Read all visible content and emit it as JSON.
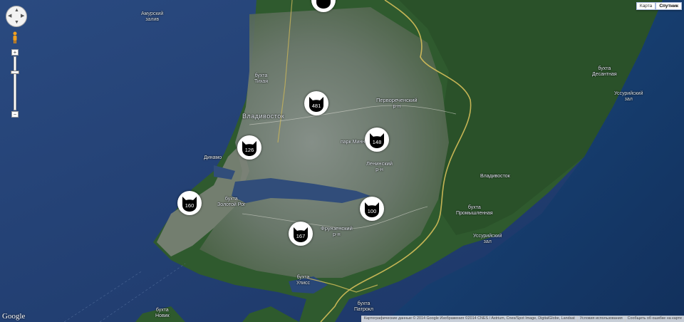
{
  "map_type": {
    "map_label": "Карта",
    "satellite_label": "Спутник",
    "selected": "satellite"
  },
  "zoom": {
    "plus": "+",
    "minus": "−"
  },
  "logo": "Google",
  "footer": {
    "attribution": "Картографические данные © 2014 Google Изображения ©2014 CNES / Astrium, Cnes/Spot Image, DigitalGlobe, Landsat",
    "terms": "Условия использования",
    "report": "Сообщить об ошибке на карте"
  },
  "labels": {
    "amur_bay": [
      "Амурский",
      "залив"
    ],
    "vladivostok_city": "Владивосток",
    "pervorechensky": [
      "Первореченский",
      "р-н"
    ],
    "leninsky": [
      "Ленинский",
      "р-н"
    ],
    "frunzensky": [
      "Фрунзенский",
      "р-н"
    ],
    "ussuri_bay_top": [
      "Уссурийский",
      "зал"
    ],
    "ussuri_bay_bottom": [
      "Уссурийский",
      "зал"
    ],
    "vladivostok_east": "Владивосток",
    "park_minny": "парк Минный",
    "dinamo": "Динамо",
    "zolotoy_rog": [
      "бухта",
      "Золотой Рог"
    ],
    "patrokl": [
      "бухта",
      "Патрокл"
    ],
    "ulysses": [
      "бухта",
      "Улисс"
    ],
    "tikhaya": [
      "бухта",
      "Тихая"
    ],
    "desantnaya": [
      "бухта",
      "Десантная"
    ],
    "promyshlenny": [
      "бухта",
      "Промышленная"
    ],
    "bottom_bay": [
      "бухта",
      "Новик"
    ]
  },
  "markers": [
    {
      "id": "top",
      "count": ""
    },
    {
      "id": "m481",
      "count": "481"
    },
    {
      "id": "m126",
      "count": "126"
    },
    {
      "id": "m148",
      "count": "148"
    },
    {
      "id": "m160",
      "count": "160"
    },
    {
      "id": "m100",
      "count": "100"
    },
    {
      "id": "m167",
      "count": "167"
    }
  ]
}
